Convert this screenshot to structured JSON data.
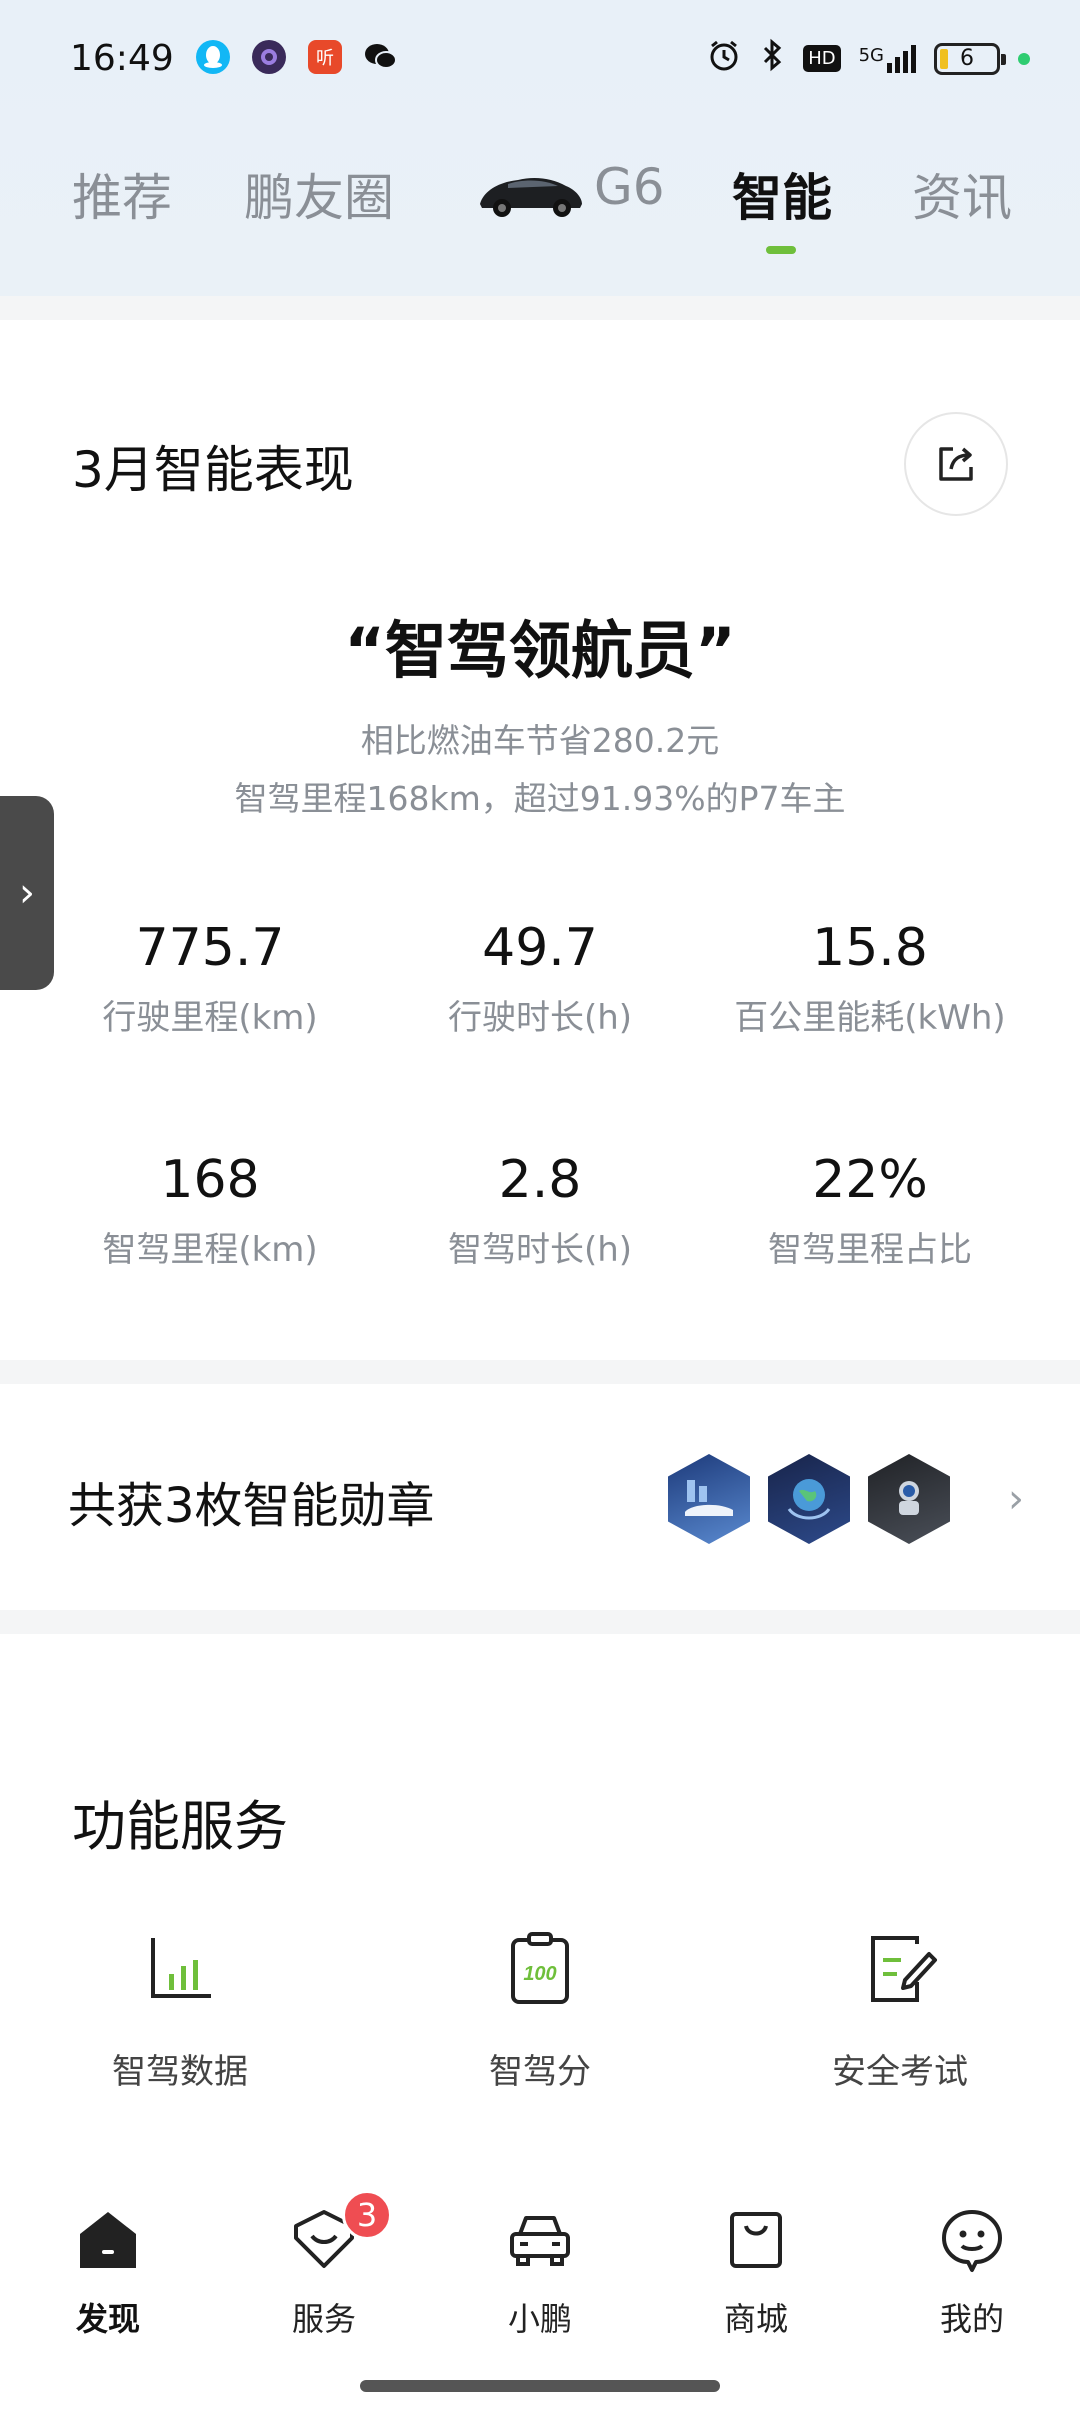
{
  "status_bar": {
    "time": "16:49",
    "battery_level": "6",
    "network": "5G",
    "hd": "HD",
    "icons": [
      "qq-icon",
      "browser-icon",
      "listen-app-icon",
      "wechat-icon",
      "alarm-icon",
      "bluetooth-icon",
      "hd-icon",
      "signal-icon",
      "battery-icon"
    ]
  },
  "top_nav": {
    "tabs": [
      {
        "label": "推荐"
      },
      {
        "label": "鹏友圈"
      },
      {
        "label": "G6"
      },
      {
        "label": "智能"
      },
      {
        "label": "资讯"
      }
    ],
    "active_index": 3,
    "accent_color": "#6fbf3b"
  },
  "report": {
    "title": "3月智能表现",
    "headline": "“智驾领航员”",
    "savings_text": "相比燃油车节省280.2元",
    "rank_text": "智驾里程168km，超过91.93%的P7车主",
    "stats": [
      {
        "value": "775.7",
        "label": "行驶里程(km)"
      },
      {
        "value": "49.7",
        "label": "行驶时长(h)"
      },
      {
        "value": "15.8",
        "label": "百公里能耗(kWh)"
      },
      {
        "value": "168",
        "label": "智驾里程(km)"
      },
      {
        "value": "2.8",
        "label": "智驾时长(h)"
      },
      {
        "value": "22%",
        "label": "智驾里程占比"
      }
    ]
  },
  "medals": {
    "title": "共获3枚智能勋章",
    "count": 3
  },
  "services": {
    "title": "功能服务",
    "items": [
      {
        "label": "智驾数据",
        "icon": "bar-chart-icon"
      },
      {
        "label": "智驾分",
        "icon": "clipboard-score-icon"
      },
      {
        "label": "安全考试",
        "icon": "exam-edit-icon"
      }
    ]
  },
  "bottom_nav": {
    "items": [
      {
        "label": "发现",
        "icon": "home-icon"
      },
      {
        "label": "服务",
        "icon": "service-icon"
      },
      {
        "label": "小鹏",
        "icon": "car-icon"
      },
      {
        "label": "商城",
        "icon": "shopping-bag-icon"
      },
      {
        "label": "我的",
        "icon": "profile-icon"
      }
    ],
    "active_index": 0,
    "service_badge": "3"
  }
}
